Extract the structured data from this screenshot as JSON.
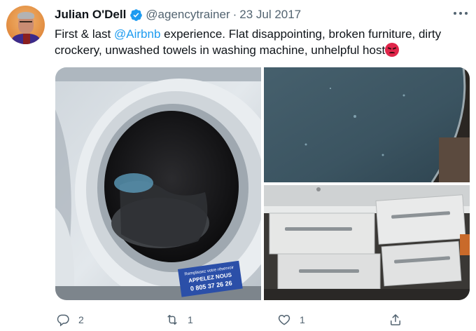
{
  "tweet": {
    "author_name": "Julian O'Dell",
    "handle": "@agencytrainer",
    "separator": "·",
    "date": "23 Jul 2017",
    "text_before_mention": "First & last ",
    "mention": "@Airbnb",
    "text_after_mention": " experience. Flat disappointing, broken furniture, dirty crockery, unwashed towels in washing machine, unhelpful host",
    "emoji": "angry-face-icon"
  },
  "photos": {
    "sticker_line1": "Remplissez votre réservoir",
    "sticker_line2": "APPELEZ NOUS",
    "sticker_line3": "0 805 37 26 26"
  },
  "actions": {
    "reply_count": "2",
    "retweet_count": "1",
    "like_count": "1"
  },
  "colors": {
    "accent": "#1d9bf0",
    "secondary_text": "#536471",
    "angry_emoji": "#e0264a"
  }
}
